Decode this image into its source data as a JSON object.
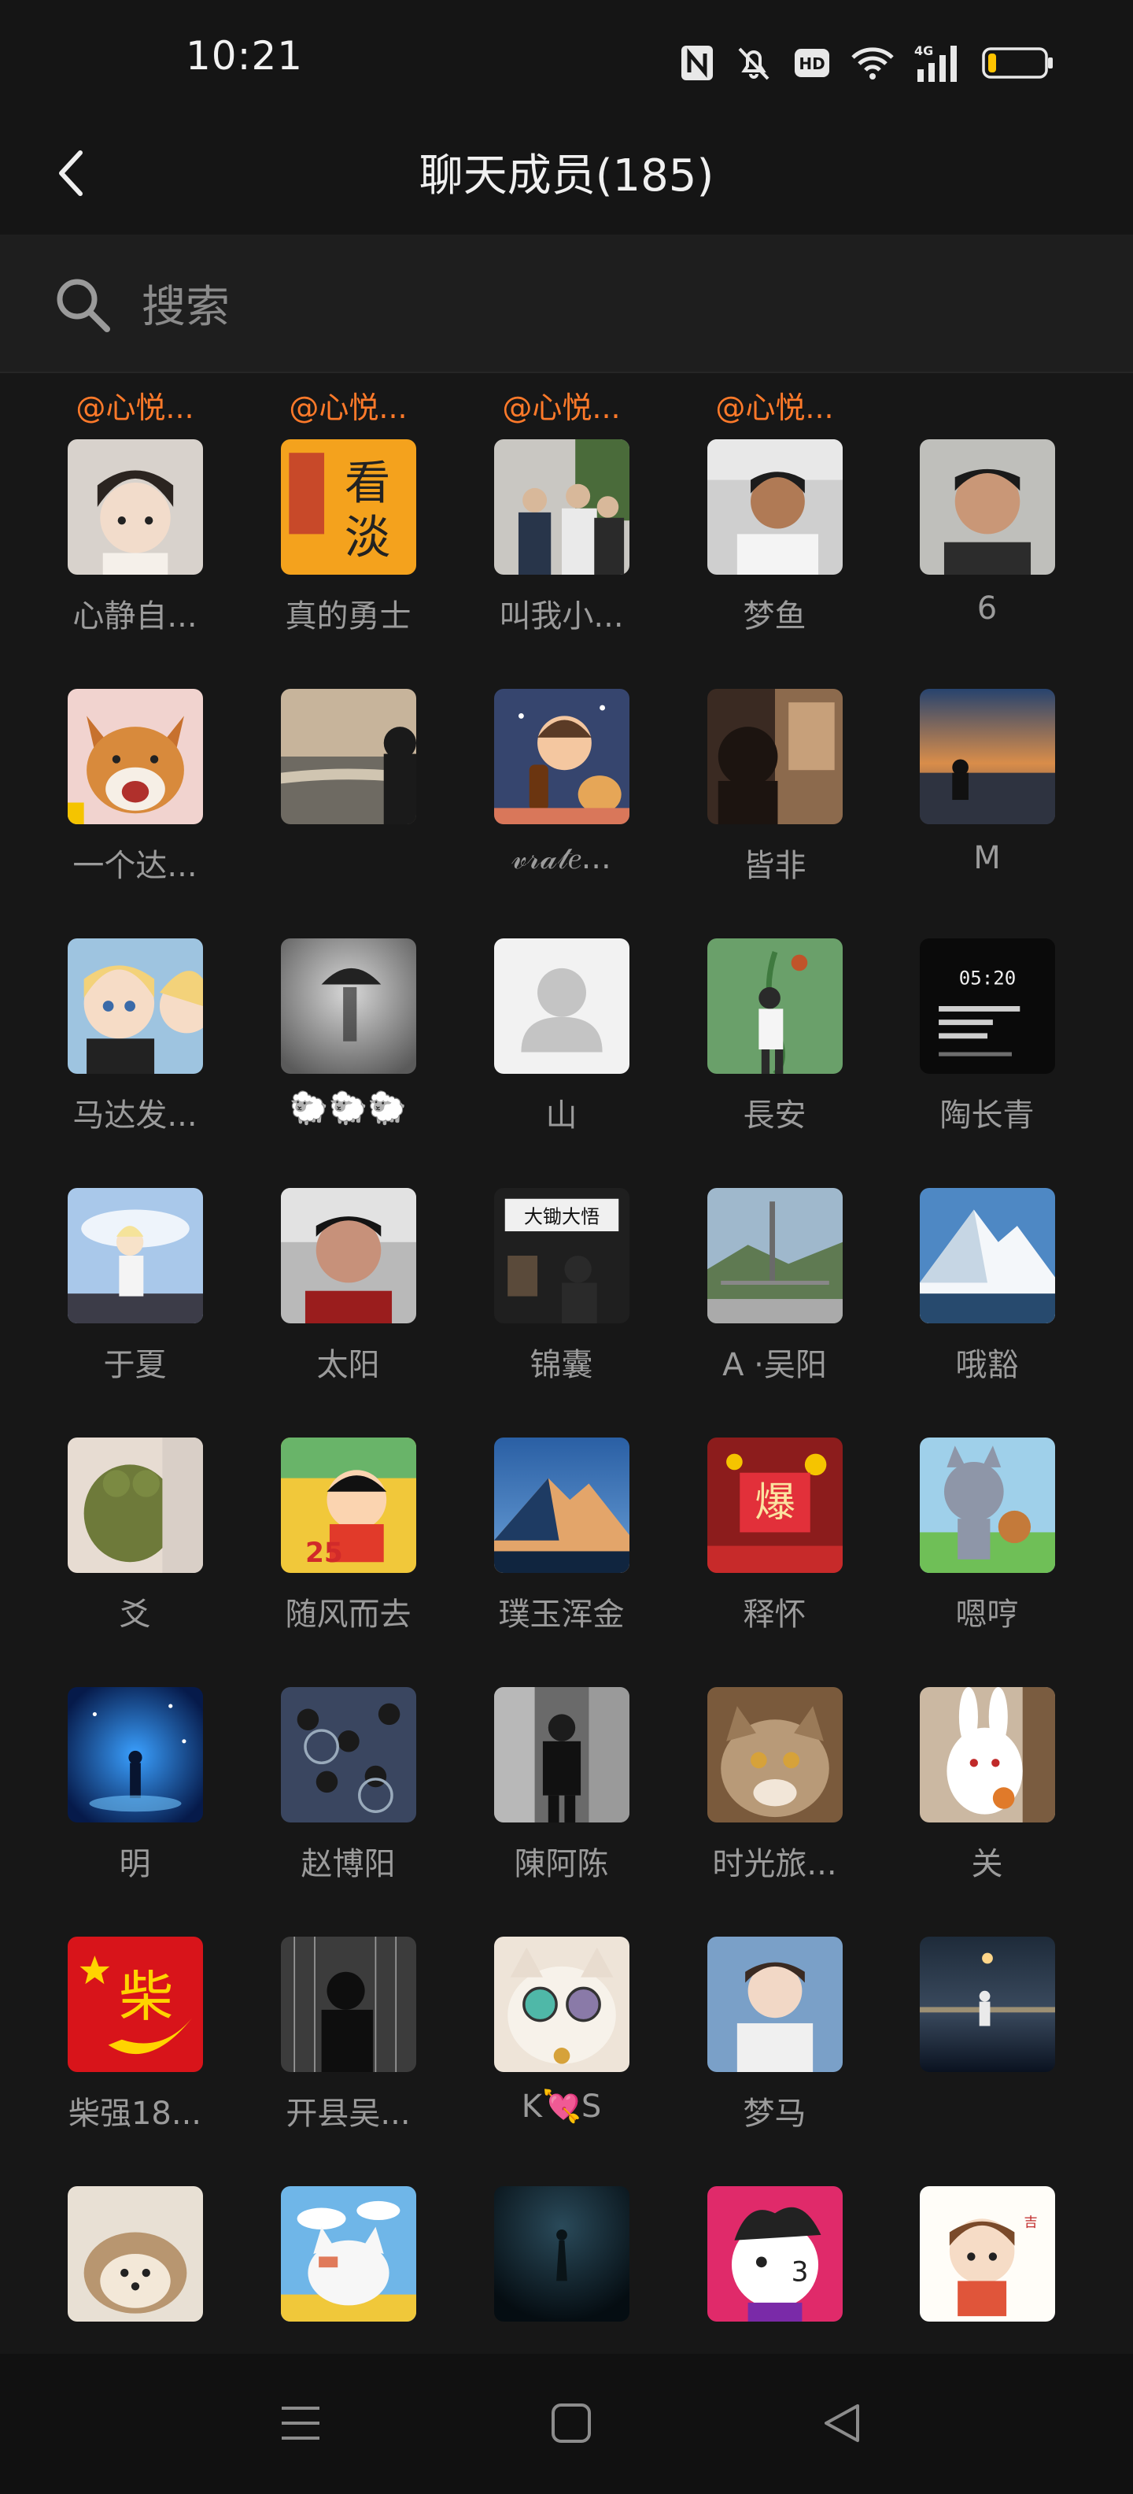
{
  "status_bar": {
    "time": "10:21",
    "icons": [
      "nfc-icon",
      "mute-icon",
      "hd-icon",
      "wifi-icon",
      "signal-4g-icon",
      "battery-icon"
    ],
    "network_label": "4G",
    "hd_label": "HD",
    "battery_level": 0.15,
    "battery_color": "#ffc400"
  },
  "header": {
    "title": "聊天成员(185)",
    "back_icon": "chevron-left-icon"
  },
  "search": {
    "placeholder": "搜索",
    "value": ""
  },
  "colors": {
    "background": "#171717",
    "mention": "#ff7a2a",
    "name": "#9b9b9b"
  },
  "members": [
    {
      "mention": "@心悦...",
      "name": "心静自..."
    },
    {
      "mention": "@心悦...",
      "name": "真的勇士"
    },
    {
      "mention": "@心悦...",
      "name": "叫我小..."
    },
    {
      "mention": "@心悦...",
      "name": "梦鱼"
    },
    {
      "mention": "",
      "name": "6"
    },
    {
      "mention": "",
      "name": "一个达..."
    },
    {
      "mention": "",
      "name": ""
    },
    {
      "mention": "",
      "name": "𝓋𝓇𝒶𝓉𝑒..."
    },
    {
      "mention": "",
      "name": "皆非"
    },
    {
      "mention": "",
      "name": "M"
    },
    {
      "mention": "",
      "name": "马达发..."
    },
    {
      "mention": "",
      "name": "🐑🐑🐑"
    },
    {
      "mention": "",
      "name": "山"
    },
    {
      "mention": "",
      "name": "長安"
    },
    {
      "mention": "",
      "name": "陶长青"
    },
    {
      "mention": "",
      "name": "于夏"
    },
    {
      "mention": "",
      "name": "太阳"
    },
    {
      "mention": "",
      "name": "锦囊"
    },
    {
      "mention": "",
      "name": "A ·吴阳"
    },
    {
      "mention": "",
      "name": "哦豁"
    },
    {
      "mention": "",
      "name": "爻"
    },
    {
      "mention": "",
      "name": "随风而去"
    },
    {
      "mention": "",
      "name": "璞玉浑金"
    },
    {
      "mention": "",
      "name": "释怀"
    },
    {
      "mention": "",
      "name": "嗯哼"
    },
    {
      "mention": "",
      "name": "明"
    },
    {
      "mention": "",
      "name": "赵博阳"
    },
    {
      "mention": "",
      "name": "陳阿陈"
    },
    {
      "mention": "",
      "name": "时光旅..."
    },
    {
      "mention": "",
      "name": "关"
    },
    {
      "mention": "",
      "name": "柴强18..."
    },
    {
      "mention": "",
      "name": "开县吴..."
    },
    {
      "mention": "",
      "name": "K💘S"
    },
    {
      "mention": "",
      "name": "梦马"
    },
    {
      "mention": "",
      "name": ""
    },
    {
      "mention": "",
      "name": ""
    },
    {
      "mention": "",
      "name": ""
    },
    {
      "mention": "",
      "name": ""
    },
    {
      "mention": "",
      "name": ""
    },
    {
      "mention": "",
      "name": ""
    }
  ],
  "nav_bar": {
    "icons": [
      "menu-icon",
      "home-square-icon",
      "back-triangle-icon"
    ]
  }
}
